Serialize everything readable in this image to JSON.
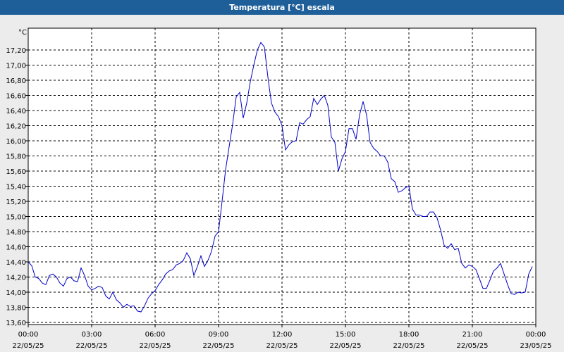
{
  "window": {
    "title": "Temperatura [°C] escala"
  },
  "colors": {
    "titlebar": "#1e5f99",
    "line": "#0000c8",
    "plot_bg": "#ffffff",
    "grid": "#000000"
  },
  "chart_data": {
    "type": "line",
    "title": "Temperatura [°C] escala",
    "ylabel": "°C",
    "xlabel": "",
    "grid": true,
    "ylim": [
      13.6,
      17.4
    ],
    "xlim": [
      "2025-05-22 00:00",
      "2025-05-23 00:00"
    ],
    "yticks": [
      "13,60",
      "13,80",
      "14,00",
      "14,20",
      "14,40",
      "14,60",
      "14,80",
      "15,00",
      "15,20",
      "15,40",
      "15,60",
      "15,80",
      "16,00",
      "16,20",
      "16,40",
      "16,60",
      "16,80",
      "17,00",
      "17,20"
    ],
    "xticks": [
      {
        "time": "00:00",
        "date": "22/05/25"
      },
      {
        "time": "03:00",
        "date": "22/05/25"
      },
      {
        "time": "06:00",
        "date": "22/05/25"
      },
      {
        "time": "09:00",
        "date": "22/05/25"
      },
      {
        "time": "12:00",
        "date": "22/05/25"
      },
      {
        "time": "15:00",
        "date": "22/05/25"
      },
      {
        "time": "18:00",
        "date": "22/05/25"
      },
      {
        "time": "21:00",
        "date": "22/05/25"
      },
      {
        "time": "00:00",
        "date": "23/05/25"
      }
    ],
    "series": [
      {
        "x": [
          "00:00",
          "00:10",
          "00:20",
          "00:30",
          "00:40",
          "00:50",
          "01:00",
          "01:10",
          "01:20",
          "01:30",
          "01:40",
          "01:50",
          "02:00",
          "02:10",
          "02:20",
          "02:30",
          "02:40",
          "02:50",
          "03:00",
          "03:10",
          "03:20",
          "03:30",
          "03:40",
          "03:50",
          "04:00",
          "04:10",
          "04:20",
          "04:30",
          "04:40",
          "04:50",
          "05:00",
          "05:10",
          "05:20",
          "05:30",
          "05:40",
          "05:50",
          "06:00",
          "06:10",
          "06:20",
          "06:30",
          "06:40",
          "06:50",
          "07:00",
          "07:10",
          "07:20",
          "07:30",
          "07:40",
          "07:50",
          "08:00",
          "08:10",
          "08:20",
          "08:30",
          "08:40",
          "08:50",
          "09:00",
          "09:10",
          "09:20",
          "09:30",
          "09:40",
          "09:50",
          "10:00",
          "10:10",
          "10:20",
          "10:30",
          "10:40",
          "10:50",
          "11:00",
          "11:10",
          "11:20",
          "11:30",
          "11:40",
          "11:50",
          "12:00",
          "12:10",
          "12:20",
          "12:30",
          "12:40",
          "12:50",
          "13:00",
          "13:10",
          "13:20",
          "13:30",
          "13:40",
          "13:50",
          "14:00",
          "14:10",
          "14:20",
          "14:30",
          "14:40",
          "14:50",
          "15:00",
          "15:10",
          "15:20",
          "15:30",
          "15:40",
          "15:50",
          "16:00",
          "16:10",
          "16:20",
          "16:30",
          "16:40",
          "16:50",
          "17:00",
          "17:10",
          "17:20",
          "17:30",
          "17:40",
          "17:50",
          "18:00",
          "18:10",
          "18:20",
          "18:30",
          "18:40",
          "18:50",
          "19:00",
          "19:10",
          "19:20",
          "19:30",
          "19:40",
          "19:50",
          "20:00",
          "20:10",
          "20:20",
          "20:30",
          "20:40",
          "20:50",
          "21:00",
          "21:10",
          "21:20",
          "21:30",
          "21:40",
          "21:50",
          "22:00",
          "22:10",
          "22:20",
          "22:30",
          "22:40",
          "22:50",
          "23:00",
          "23:10",
          "23:20",
          "23:30",
          "23:40",
          "23:50"
        ],
        "values": [
          14.4,
          14.35,
          14.2,
          14.18,
          14.12,
          14.1,
          14.22,
          14.24,
          14.2,
          14.12,
          14.08,
          14.18,
          14.2,
          14.15,
          14.14,
          14.32,
          14.22,
          14.08,
          14.03,
          14.05,
          14.08,
          14.06,
          13.95,
          13.91,
          14.0,
          13.9,
          13.86,
          13.8,
          13.84,
          13.81,
          13.82,
          13.75,
          13.74,
          13.82,
          13.92,
          13.98,
          14.02,
          14.1,
          14.16,
          14.24,
          14.28,
          14.3,
          14.36,
          14.38,
          14.42,
          14.52,
          14.44,
          14.22,
          14.34,
          14.48,
          14.34,
          14.42,
          14.54,
          14.74,
          14.8,
          15.2,
          15.62,
          15.92,
          16.22,
          16.58,
          16.64,
          16.3,
          16.5,
          16.78,
          17.0,
          17.2,
          17.3,
          17.24,
          16.84,
          16.5,
          16.38,
          16.32,
          16.2,
          15.88,
          15.95,
          15.99,
          16.0,
          16.24,
          16.22,
          16.28,
          16.32,
          16.56,
          16.48,
          16.55,
          16.6,
          16.47,
          16.05,
          15.98,
          15.6,
          15.76,
          15.86,
          16.16,
          16.16,
          16.02,
          16.34,
          16.52,
          16.34,
          15.98,
          15.9,
          15.86,
          15.8,
          15.8,
          15.72,
          15.5,
          15.46,
          15.32,
          15.34,
          15.38,
          15.4,
          15.1,
          15.02,
          15.02,
          15.0,
          15.0,
          15.06,
          15.06,
          14.98,
          14.82,
          14.62,
          14.58,
          14.64,
          14.56,
          14.58,
          14.38,
          14.32,
          14.36,
          14.34,
          14.3,
          14.18,
          14.05,
          14.05,
          14.16,
          14.28,
          14.32,
          14.38,
          14.24,
          14.1,
          13.98,
          13.97,
          14.0,
          13.99,
          14.0,
          14.24,
          14.34
        ]
      }
    ]
  }
}
